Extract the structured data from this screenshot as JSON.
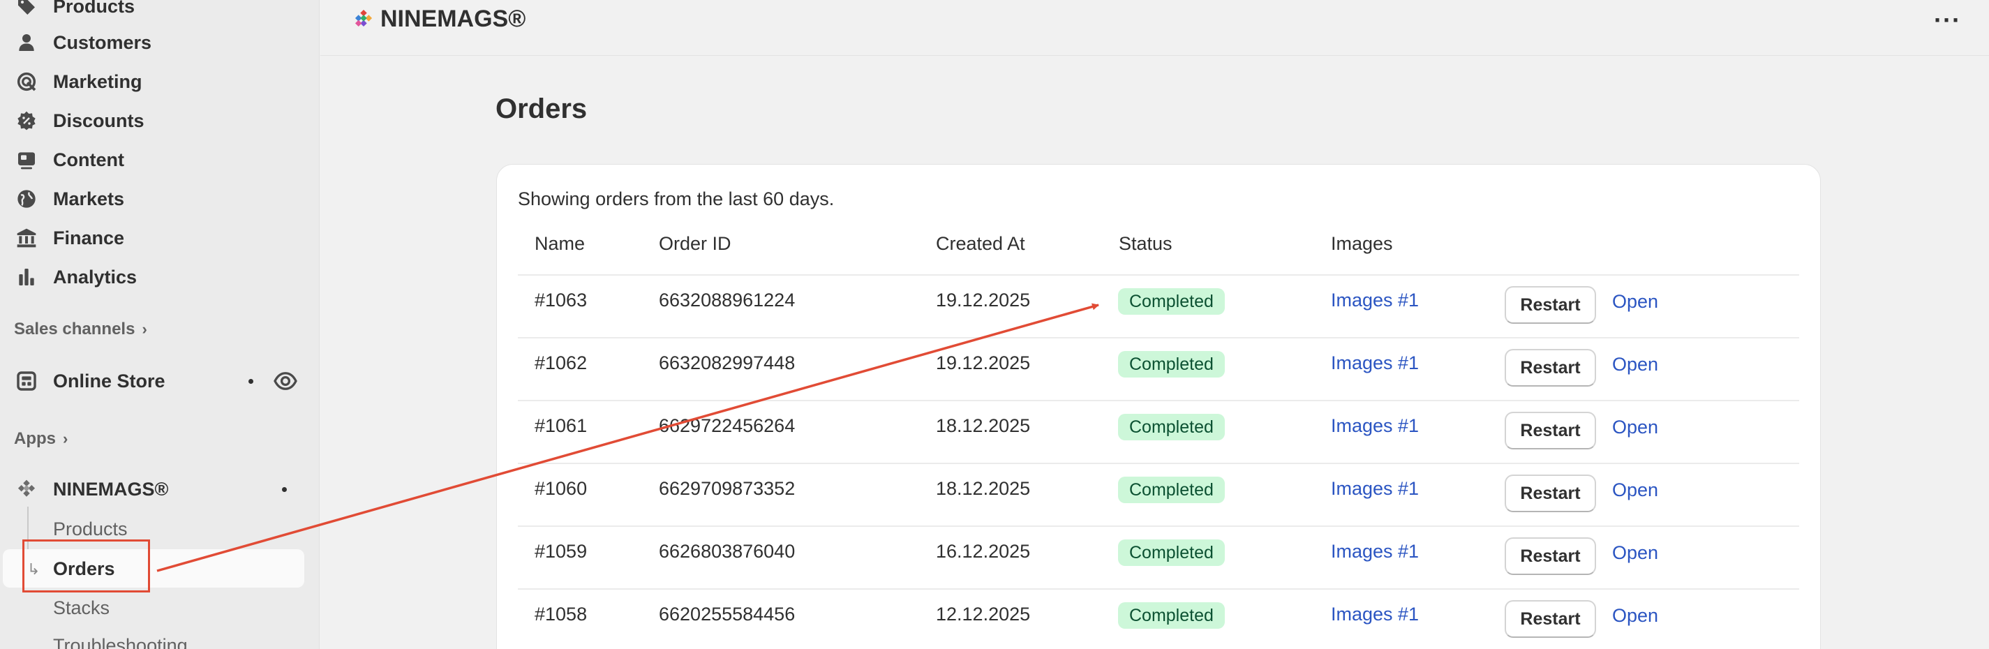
{
  "sidebar": {
    "nav": [
      {
        "label": "Products",
        "icon": "tag-icon"
      },
      {
        "label": "Customers",
        "icon": "person-icon"
      },
      {
        "label": "Marketing",
        "icon": "target-icon"
      },
      {
        "label": "Discounts",
        "icon": "discount-icon"
      },
      {
        "label": "Content",
        "icon": "image-icon"
      },
      {
        "label": "Markets",
        "icon": "globe-icon"
      },
      {
        "label": "Finance",
        "icon": "bank-icon"
      },
      {
        "label": "Analytics",
        "icon": "bar-chart-icon"
      }
    ],
    "sales_channels_label": "Sales channels",
    "online_store": {
      "label": "Online Store",
      "icon": "store-icon",
      "view_icon": "eye-icon"
    },
    "apps_label": "Apps",
    "app": {
      "name": "NINEMAGS®",
      "icon": "app-logo-icon",
      "sub_items": [
        {
          "label": "Products"
        },
        {
          "label": "Orders",
          "active": true
        },
        {
          "label": "Stacks"
        },
        {
          "label": "Troubleshooting"
        }
      ]
    }
  },
  "topbar": {
    "brand": "NINEMAGS®",
    "more_label": "···"
  },
  "page": {
    "title": "Orders",
    "note": "Showing orders from the last 60 days.",
    "columns": [
      "Name",
      "Order ID",
      "Created At",
      "Status",
      "Images"
    ],
    "restart_label": "Restart",
    "open_label": "Open",
    "orders": [
      {
        "name": "#1063",
        "order_id": "6632088961224",
        "created_at": "19.12.2025",
        "status": "Completed",
        "images": "Images #1"
      },
      {
        "name": "#1062",
        "order_id": "6632082997448",
        "created_at": "19.12.2025",
        "status": "Completed",
        "images": "Images #1"
      },
      {
        "name": "#1061",
        "order_id": "6629722456264",
        "created_at": "18.12.2025",
        "status": "Completed",
        "images": "Images #1"
      },
      {
        "name": "#1060",
        "order_id": "6629709873352",
        "created_at": "18.12.2025",
        "status": "Completed",
        "images": "Images #1"
      },
      {
        "name": "#1059",
        "order_id": "6626803876040",
        "created_at": "16.12.2025",
        "status": "Completed",
        "images": "Images #1"
      },
      {
        "name": "#1058",
        "order_id": "6620255584456",
        "created_at": "12.12.2025",
        "status": "Completed",
        "images": "Images #1"
      }
    ]
  },
  "colors": {
    "annotation": "#e14b35",
    "badge_bg": "#cdf7d9",
    "badge_text": "#0c5132",
    "link": "#2b55c2"
  }
}
